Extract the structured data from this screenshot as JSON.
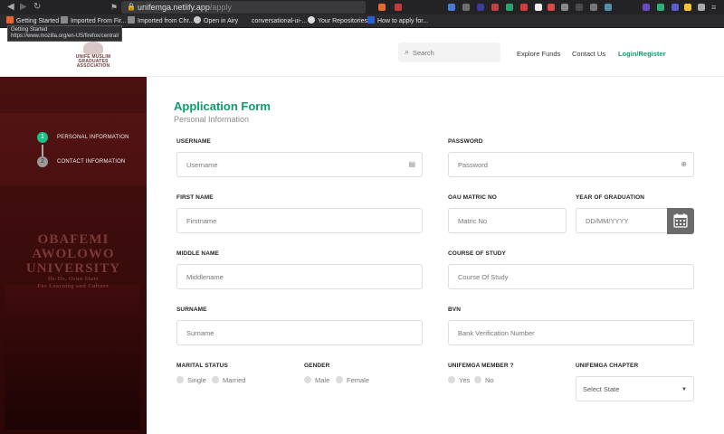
{
  "browser": {
    "url_host": "unifemga.netlify.app",
    "url_path": "/apply",
    "bookmarks": [
      "Getting Started",
      "Imported From Fir...",
      "Imported from Chr...",
      "Open in Airy",
      "conversational-ui-...",
      "Your Repositories",
      "How to apply for..."
    ],
    "tooltip_title": "Getting Started",
    "tooltip_url": "https://www.mozilla.org/en-US/firefox/central/"
  },
  "header": {
    "logo_text": "UNIFE MUSLIM GRADUATES ASSOCIATION",
    "search_placeholder": "Search",
    "nav": [
      "Explore Funds",
      "Contact Us",
      "Login/Register"
    ]
  },
  "sidebar": {
    "steps": [
      {
        "num": "1",
        "label": "PERSONAL INFORMATION"
      },
      {
        "num": "2",
        "label": "CONTACT INFORMATION"
      }
    ],
    "bg_text_line1": "OBAFEMI AWOLOWO",
    "bg_text_line2": "UNIVERSITY",
    "bg_text_line3": "Ile-Ife, Osun State",
    "bg_text_line4": "For Learning and Culture"
  },
  "form": {
    "title": "Application Form",
    "subtitle": "Personal Information",
    "labels": {
      "username": "USERNAME",
      "password": "PASSWORD",
      "first_name": "FIRST NAME",
      "matric": "OAU MATRIC NO",
      "year": "YEAR OF GRADUATION",
      "middle_name": "MIDDLE NAME",
      "course": "COURSE OF STUDY",
      "surname": "SURNAME",
      "bvn": "BVN",
      "marital": "MARITAL STATUS",
      "gender": "GENDER",
      "member": "UNIFEMGA MEMBER ?",
      "chapter": "UNIFEMGA CHAPTER"
    },
    "placeholders": {
      "username": "Username",
      "password": "Password",
      "first_name": "Firstname",
      "matric": "Matric No",
      "year": "DD/MM/YYYY",
      "middle_name": "Middlename",
      "course": "Course Of Study",
      "surname": "Surname",
      "bvn": "Bank Verification Number"
    },
    "marital_options": [
      "Single",
      "Married"
    ],
    "gender_options": [
      "Male",
      "Female"
    ],
    "member_options": [
      "Yes",
      "No"
    ],
    "chapter_selected": "Select State"
  },
  "colors": {
    "accent": "#0d9c6a",
    "step_active": "#1ec08a",
    "sidebar_bg": "#4a1010"
  }
}
